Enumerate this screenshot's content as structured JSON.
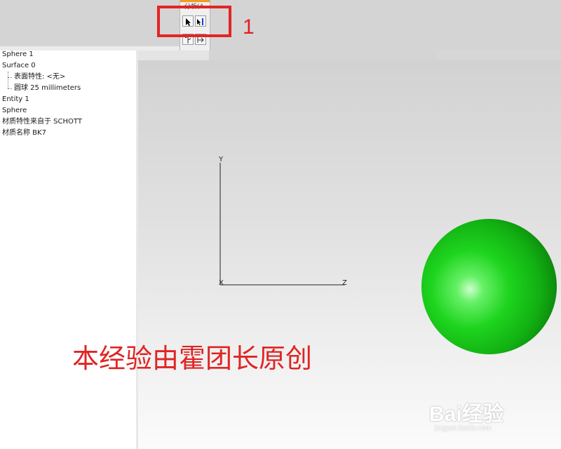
{
  "toolbar": {
    "menu_fragment": "分析(A",
    "select_icon": "arrow-pointer-icon",
    "probe_icon": "arrow-probe-icon"
  },
  "annotation": {
    "step_number": "1",
    "highlight_color": "#e32424"
  },
  "tree": {
    "items": [
      {
        "label": "Sphere 1"
      },
      {
        "label": "Surface 0"
      },
      {
        "label": "表面特性: <无>"
      },
      {
        "label": "圆球 25 millimeters"
      },
      {
        "label": "Entity 1"
      },
      {
        "label": "Sphere"
      },
      {
        "label": "材质特性来自于 SCHOTT"
      },
      {
        "label": "材质名称 BK7"
      }
    ]
  },
  "viewport": {
    "axis_y": "Y",
    "axis_x": "X",
    "axis_z": "Z",
    "sphere_color": "#1ed41e"
  },
  "watermark": {
    "text": "本经验由霍团长原创",
    "color": "#e02424"
  },
  "logo": {
    "brand": "Bai经验",
    "url": "jingyan.baidu.com"
  }
}
